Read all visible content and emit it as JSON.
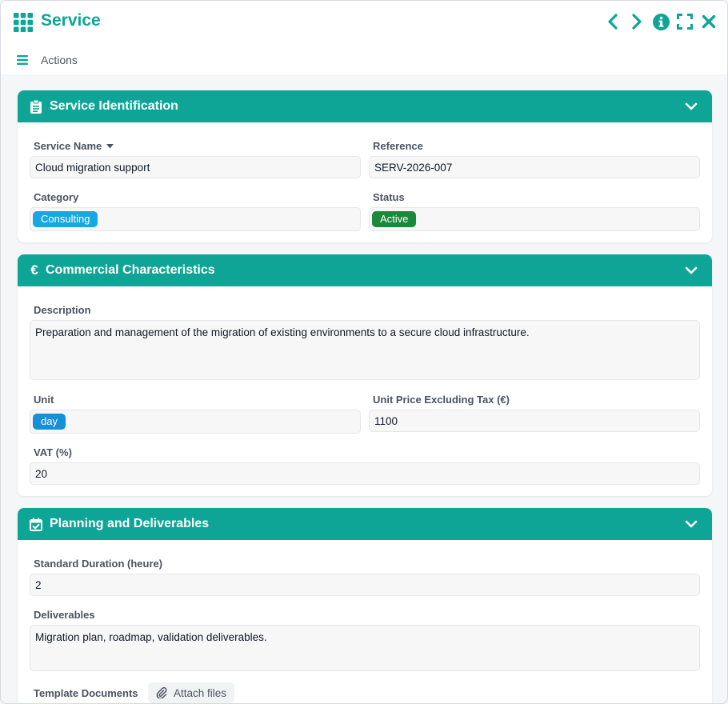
{
  "app": {
    "title": "Service",
    "accent_color": "#0fa596",
    "icons": [
      "app-grid-icon",
      "chevron-left-icon",
      "chevron-right-icon",
      "info-icon",
      "expand-icon",
      "close-icon"
    ]
  },
  "toolbar": {
    "menu_icon": "hamburger-icon",
    "actions_label": "Actions"
  },
  "sections": {
    "identification": {
      "title": "Service Identification",
      "icon": "clipboard-icon",
      "service_name_label": "Service Name",
      "service_name_value": "Cloud migration support",
      "reference_label": "Reference",
      "reference_value": "SERV-2026-007",
      "category_label": "Category",
      "category_value": "Consulting",
      "category_color": "#17a8e0",
      "status_label": "Status",
      "status_value": "Active",
      "status_color": "#198a3a"
    },
    "commercial": {
      "title": "Commercial Characteristics",
      "icon": "euro-icon",
      "description_label": "Description",
      "description_value": "Preparation and management of the migration of existing environments to a secure cloud infrastructure.",
      "unit_label": "Unit",
      "unit_value": "day",
      "unit_color": "#1790d8",
      "price_label": "Unit Price Excluding Tax (€)",
      "price_value": "1100",
      "vat_label": "VAT (%)",
      "vat_value": "20"
    },
    "planning": {
      "title": "Planning and Deliverables",
      "icon": "calendar-check-icon",
      "duration_label": "Standard Duration (heure)",
      "duration_value": "2",
      "deliverables_label": "Deliverables",
      "deliverables_value": "Migration plan, roadmap, validation deliverables.",
      "templates_label": "Template Documents",
      "attach_label": "Attach files"
    }
  }
}
